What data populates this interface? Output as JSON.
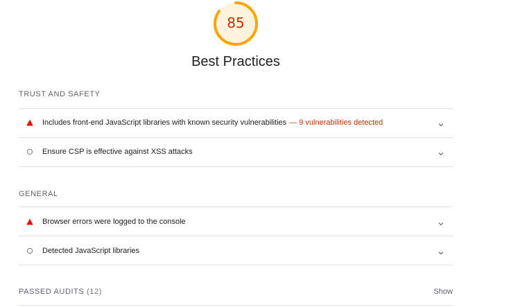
{
  "category": {
    "score": "85",
    "score_fraction": 0.85,
    "title": "Best Practices",
    "colors": {
      "gauge": "#ffa400",
      "gauge_track": "#fff3dd",
      "score_text": "#c33300",
      "fail": "#eb0f00",
      "info": "#757575"
    }
  },
  "groups": [
    {
      "title": "Trust and Safety",
      "audits": [
        {
          "status_icon": "fail-triangle-icon",
          "title": "Includes front-end JavaScript libraries with known security vulnerabilities",
          "display_value": "— 9 vulnerabilities detected"
        },
        {
          "status_icon": "info-circle-icon",
          "title": "Ensure CSP is effective against XSS attacks",
          "display_value": ""
        }
      ]
    },
    {
      "title": "General",
      "audits": [
        {
          "status_icon": "fail-triangle-icon",
          "title": "Browser errors were logged to the console",
          "display_value": ""
        },
        {
          "status_icon": "info-circle-icon",
          "title": "Detected JavaScript libraries",
          "display_value": ""
        }
      ]
    }
  ],
  "passed": {
    "label": "Passed audits",
    "count": "(12)",
    "toggle": "Show"
  }
}
